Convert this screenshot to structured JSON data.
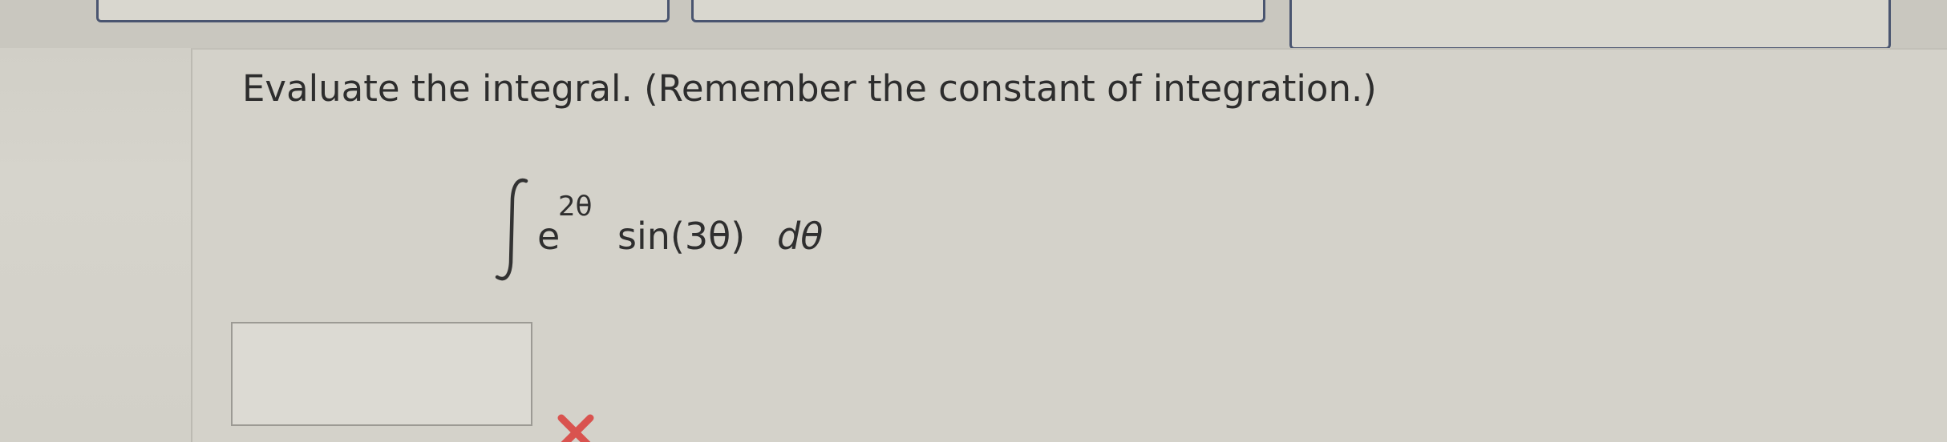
{
  "question": {
    "prompt": "Evaluate the integral. (Remember the constant of integration.)",
    "expression": {
      "integral_symbol": "∫",
      "base": "e",
      "exponent": "2θ",
      "function": "sin(3θ)",
      "differential": "dθ"
    }
  },
  "answer": {
    "value": "",
    "placeholder": ""
  },
  "status": {
    "icon": "red-x-icon",
    "color": "#d9534f"
  },
  "colors": {
    "box_border": "#4a5570",
    "text": "#2d2d2d"
  }
}
